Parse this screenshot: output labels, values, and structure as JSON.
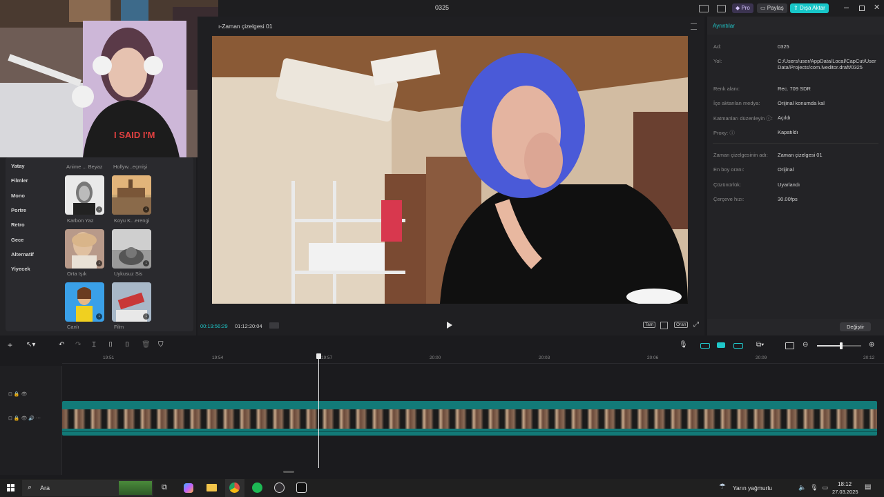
{
  "app": {
    "window_title": "0325",
    "pro_label": "Pro",
    "share_label": "Paylaş",
    "export_label": "Dışa Aktar"
  },
  "left_panel": {
    "categories": [
      "Yatay",
      "Filmler",
      "Mono",
      "Portre",
      "Retro",
      "Gece",
      "Alternatif",
      "Yiyecek"
    ],
    "top_labels": [
      "Anime ... Beyaz",
      "Hollyw...eçmişi"
    ],
    "filters": [
      {
        "label": "Karbon Yaz"
      },
      {
        "label": "Koyu K...erengi"
      },
      {
        "label": "Orta Işık"
      },
      {
        "label": "Uykusuz Sis"
      },
      {
        "label": "Canlı"
      },
      {
        "label": "Film"
      }
    ]
  },
  "player": {
    "title": "ı-Zaman çizelgesi 01",
    "current_time": "00:19:56:29",
    "total_time": "01:12:20:04",
    "full_label": "Tam",
    "ratio_label": "Oran"
  },
  "details": {
    "title": "Ayrıntılar",
    "rows": [
      {
        "key": "Ad:",
        "value": "0325"
      },
      {
        "key": "Yol:",
        "value": "C:/Users/user/AppData/Local/CapCut/User Data/Projects/com.lveditor.draft/0325"
      },
      {
        "key": "Renk alanı:",
        "value": "Rec. 709 SDR"
      },
      {
        "key": "İçe aktarılan medya:",
        "value": "Orijinal konumda kal"
      },
      {
        "key": "Katmanları düzenleyin ⓘ:",
        "value": "Açıldı"
      },
      {
        "key": "Proxy: ⓘ",
        "value": "Kapatıldı"
      }
    ],
    "rows2": [
      {
        "key": "Zaman çizelgesinin adı:",
        "value": "Zaman çizelgesi 01"
      },
      {
        "key": "En boy oranı:",
        "value": "Orijinal"
      },
      {
        "key": "Çözünürlük:",
        "value": "Uyarlandı"
      },
      {
        "key": "Çerçeve hızı:",
        "value": "30.00fps"
      }
    ],
    "change_label": "Değiştir"
  },
  "timeline": {
    "ticks": [
      "19:51",
      "19:54",
      "19:57",
      "20:00",
      "20:03",
      "20:06",
      "20:09",
      "20:12"
    ]
  },
  "taskbar": {
    "search_label": "Ara",
    "weather": "Yarın yağmurlu",
    "clock_time": "18:12",
    "clock_date": "27.03.2025"
  },
  "colors": {
    "accent": "#1fc7c9",
    "export_bg": "#17c6c8",
    "clip_teal": "#127a78"
  }
}
